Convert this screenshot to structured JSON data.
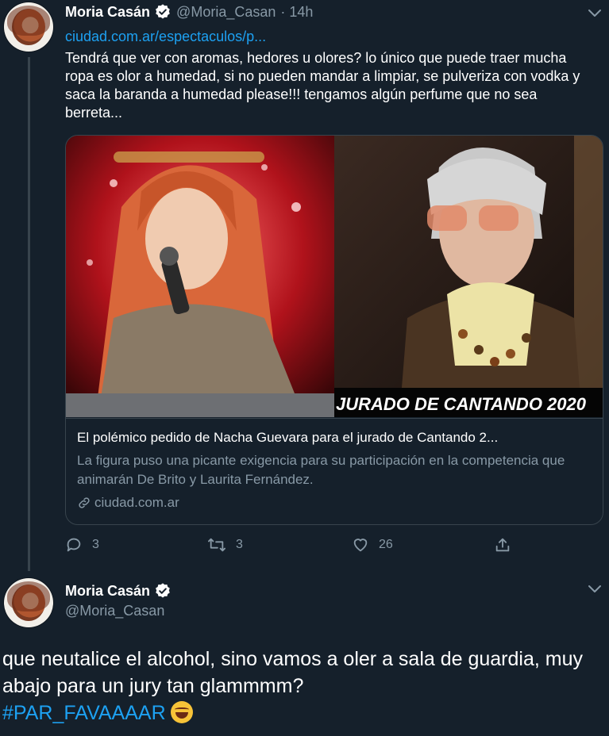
{
  "tweet1": {
    "name": "Moria Casán",
    "handle": "@Moria_Casan",
    "time": "· 14h",
    "link": "ciudad.com.ar/espectaculos/p...",
    "text": "Tendrá que ver con aromas, hedores u olores? lo único que puede traer mucha ropa es olor a humedad, si no pueden mandar a limpiar, se pulveriza con vodka y saca la baranda a humedad please!!! tengamos algún perfume que no sea berreta...",
    "card": {
      "image_banner": "JURADO DE CANTANDO 2020",
      "title": "El polémico pedido de Nacha Guevara para el jurado de Cantando 2...",
      "description": "La figura puso una picante exigencia para su participación en la competencia que animarán De Brito y Laurita Fernández.",
      "domain": "ciudad.com.ar"
    },
    "actions": {
      "replies": "3",
      "retweets": "3",
      "likes": "26"
    }
  },
  "tweet2": {
    "name": "Moria Casán",
    "handle": "@Moria_Casan",
    "text": "que neutalice el alcohol, sino vamos a oler a sala de guardia, muy abajo para un jury tan glammmm?",
    "hashtag": "#PAR_FAVAAAAR"
  },
  "colors": {
    "background": "#15202b",
    "accent": "#1da1f2",
    "muted": "#8899a6",
    "border": "#38444d"
  },
  "icons": [
    "verified-badge-icon",
    "chevron-down-icon",
    "link-icon",
    "reply-icon",
    "retweet-icon",
    "like-icon",
    "share-icon",
    "rolling-laughing-emoji"
  ]
}
